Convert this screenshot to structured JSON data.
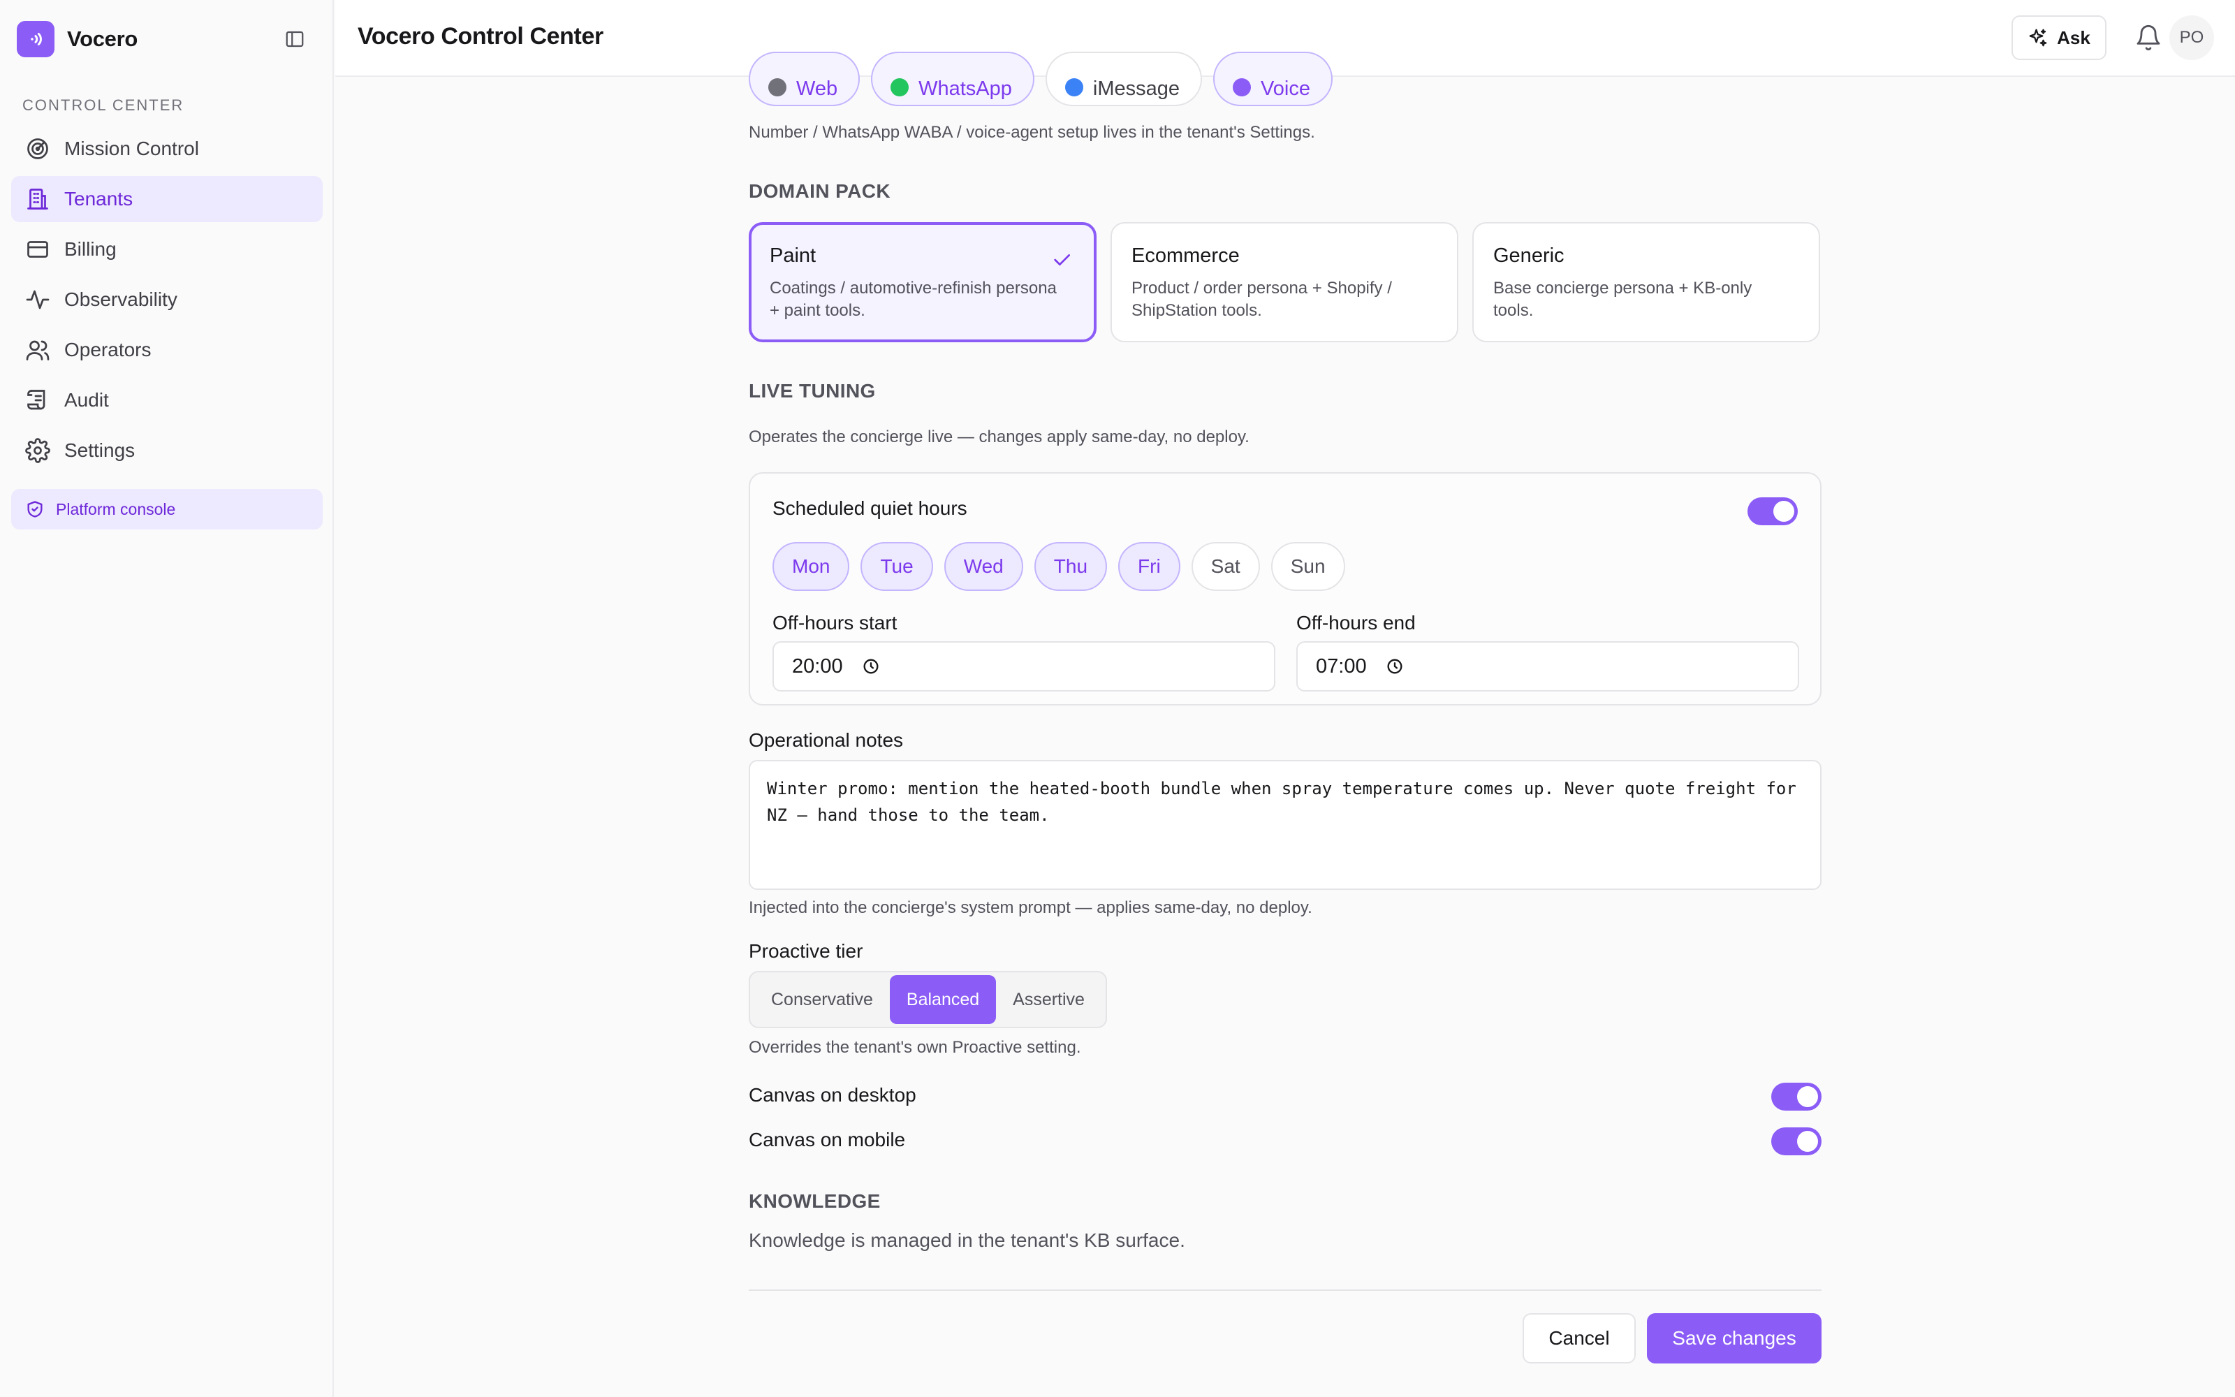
{
  "app": {
    "name": "Vocero",
    "title": "Vocero Control Center"
  },
  "sidebar": {
    "section_label": "CONTROL CENTER",
    "items": [
      {
        "label": "Mission Control",
        "icon": "radar-icon",
        "active": false
      },
      {
        "label": "Tenants",
        "icon": "building-icon",
        "active": true
      },
      {
        "label": "Billing",
        "icon": "credit-card-icon",
        "active": false
      },
      {
        "label": "Observability",
        "icon": "activity-icon",
        "active": false
      },
      {
        "label": "Operators",
        "icon": "users-icon",
        "active": false
      },
      {
        "label": "Audit",
        "icon": "scroll-icon",
        "active": false
      },
      {
        "label": "Settings",
        "icon": "gear-icon",
        "active": false
      }
    ],
    "platform_console": "Platform console"
  },
  "header": {
    "ask": "Ask",
    "avatar": "PO"
  },
  "channels": {
    "items": [
      {
        "label": "Web",
        "enabled": true,
        "color": "#71717a"
      },
      {
        "label": "WhatsApp",
        "enabled": true,
        "color": "#22c55e"
      },
      {
        "label": "iMessage",
        "enabled": false,
        "color": "#3b82f6"
      },
      {
        "label": "Voice",
        "enabled": true,
        "color": "#8b5cf6"
      }
    ],
    "help": "Number / WhatsApp WABA / voice-agent setup lives in the tenant's Settings."
  },
  "domain_pack": {
    "heading": "DOMAIN PACK",
    "options": [
      {
        "name": "Paint",
        "desc": "Coatings / automotive-refinish persona + paint tools.",
        "selected": true
      },
      {
        "name": "Ecommerce",
        "desc": "Product / order persona + Shopify / ShipStation tools.",
        "selected": false
      },
      {
        "name": "Generic",
        "desc": "Base concierge persona + KB-only tools.",
        "selected": false
      }
    ]
  },
  "live_tuning": {
    "heading": "LIVE TUNING",
    "subtitle": "Operates the concierge live — changes apply same-day, no deploy.",
    "quiet_hours": {
      "label": "Scheduled quiet hours",
      "enabled": true,
      "days": [
        {
          "label": "Mon",
          "on": true
        },
        {
          "label": "Tue",
          "on": true
        },
        {
          "label": "Wed",
          "on": true
        },
        {
          "label": "Thu",
          "on": true
        },
        {
          "label": "Fri",
          "on": true
        },
        {
          "label": "Sat",
          "on": false
        },
        {
          "label": "Sun",
          "on": false
        }
      ],
      "start_label": "Off-hours start",
      "start_value": "20:00",
      "end_label": "Off-hours end",
      "end_value": "07:00"
    },
    "notes_label": "Operational notes",
    "notes_value": "Winter promo: mention the heated-booth bundle when spray temperature comes up. Never quote freight for NZ — hand those to the team.",
    "notes_help": "Injected into the concierge's system prompt — applies same-day, no deploy.",
    "proactive_label": "Proactive tier",
    "proactive_options": [
      "Conservative",
      "Balanced",
      "Assertive"
    ],
    "proactive_selected": "Balanced",
    "proactive_help": "Overrides the tenant's own Proactive setting.",
    "canvas_desktop_label": "Canvas on desktop",
    "canvas_desktop": true,
    "canvas_mobile_label": "Canvas on mobile",
    "canvas_mobile": true
  },
  "knowledge": {
    "heading": "KNOWLEDGE",
    "text": "Knowledge is managed in the tenant's KB surface."
  },
  "actions": {
    "cancel": "Cancel",
    "save": "Save changes"
  },
  "colors": {
    "accent": "#8b5cf6",
    "accent_soft": "#ede9fe",
    "accent_text": "#6d28d9"
  }
}
